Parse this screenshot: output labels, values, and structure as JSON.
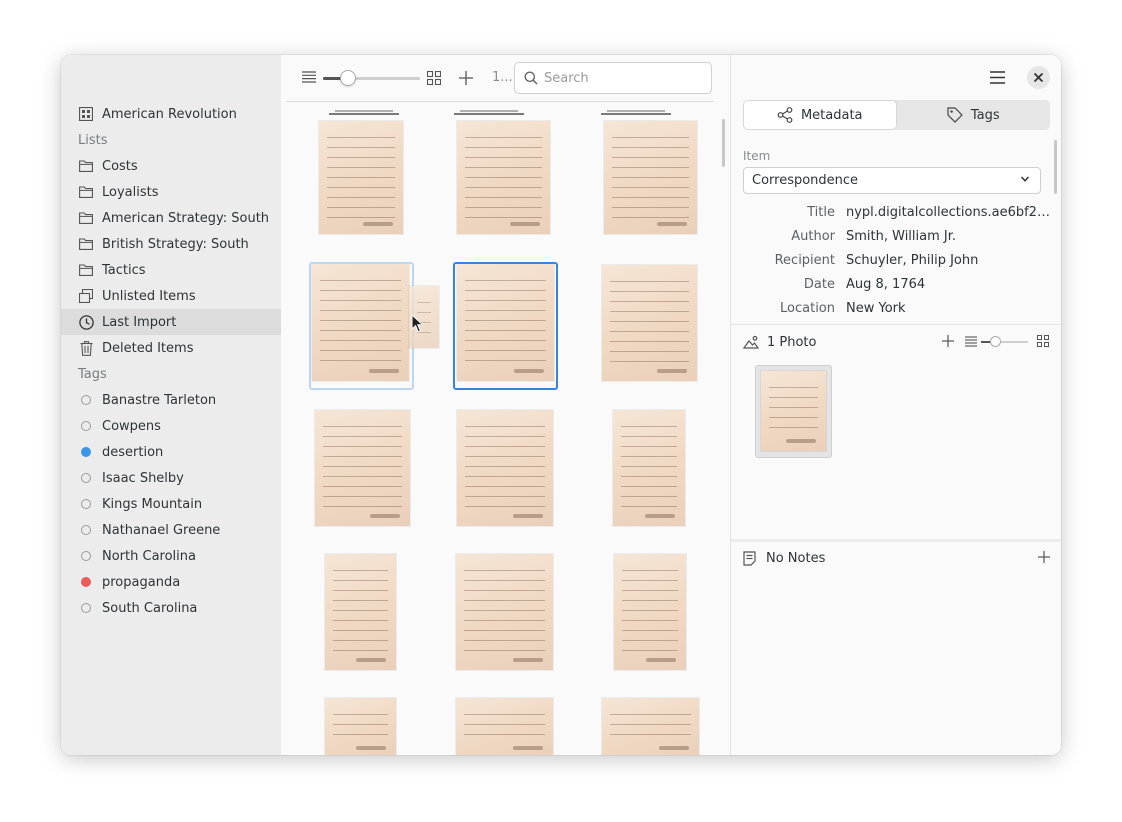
{
  "sidebar": {
    "collection": "American Revolution",
    "lists_header": "Lists",
    "lists": [
      {
        "label": "Costs",
        "icon": "folder-icon"
      },
      {
        "label": "Loyalists",
        "icon": "folder-icon"
      },
      {
        "label": "American Strategy: South",
        "icon": "folder-icon"
      },
      {
        "label": "British Strategy: South",
        "icon": "folder-icon"
      },
      {
        "label": "Tactics",
        "icon": "folder-icon"
      },
      {
        "label": "Unlisted Items",
        "icon": "unlisted-icon"
      },
      {
        "label": "Last Import",
        "icon": "clock-icon"
      },
      {
        "label": "Deleted Items",
        "icon": "trash-icon"
      }
    ],
    "tags_header": "Tags",
    "tags": [
      {
        "label": "Banastre Tarleton",
        "color": ""
      },
      {
        "label": "Cowpens",
        "color": ""
      },
      {
        "label": "desertion",
        "color": "#3a96e8"
      },
      {
        "label": "Isaac Shelby",
        "color": ""
      },
      {
        "label": "Kings Mountain",
        "color": ""
      },
      {
        "label": "Nathanael Greene",
        "color": ""
      },
      {
        "label": "North Carolina",
        "color": ""
      },
      {
        "label": "propaganda",
        "color": "#ec5a5a"
      },
      {
        "label": "South Carolina",
        "color": ""
      }
    ]
  },
  "toolbar": {
    "count": "1...",
    "search_placeholder": "Search",
    "zoom_level": 0.25
  },
  "panel": {
    "tabs": {
      "metadata": "Metadata",
      "tags": "Tags"
    },
    "item_label": "Item",
    "item_type": "Correspondence",
    "fields": [
      {
        "key": "Title",
        "value": "nypl.digitalcollections.ae6bf2c..."
      },
      {
        "key": "Author",
        "value": "Smith, William Jr."
      },
      {
        "key": "Recipient",
        "value": "Schuyler, Philip John"
      },
      {
        "key": "Date",
        "value": "Aug 8, 1764"
      },
      {
        "key": "Location",
        "value": "New York"
      }
    ],
    "photos_label": "1 Photo",
    "photo_zoom_level": 0.3,
    "notes_label": "No Notes"
  },
  "colors": {
    "accent": "#3584e4",
    "selected_row": "#dcdcdc"
  }
}
